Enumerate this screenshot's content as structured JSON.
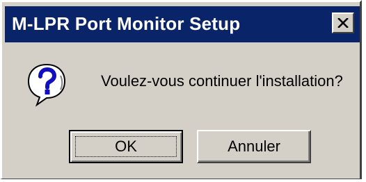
{
  "dialog": {
    "title": "M-LPR Port Monitor Setup",
    "message": "Voulez-vous continuer l'installation?",
    "icon": "question-icon",
    "buttons": {
      "ok_label": "OK",
      "cancel_label": "Annuler"
    }
  },
  "colors": {
    "titlebar": "#0a246a",
    "face": "#d4d0c8"
  }
}
